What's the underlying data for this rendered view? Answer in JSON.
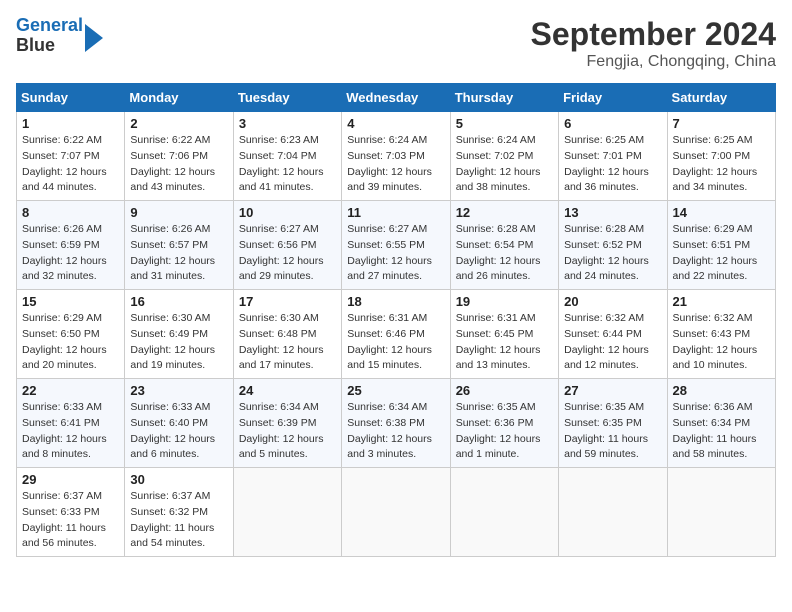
{
  "header": {
    "logo_line1": "General",
    "logo_line2": "Blue",
    "month": "September 2024",
    "location": "Fengjia, Chongqing, China"
  },
  "weekdays": [
    "Sunday",
    "Monday",
    "Tuesday",
    "Wednesday",
    "Thursday",
    "Friday",
    "Saturday"
  ],
  "weeks": [
    [
      {
        "day": "1",
        "sunrise": "6:22 AM",
        "sunset": "7:07 PM",
        "daylight": "12 hours and 44 minutes."
      },
      {
        "day": "2",
        "sunrise": "6:22 AM",
        "sunset": "7:06 PM",
        "daylight": "12 hours and 43 minutes."
      },
      {
        "day": "3",
        "sunrise": "6:23 AM",
        "sunset": "7:04 PM",
        "daylight": "12 hours and 41 minutes."
      },
      {
        "day": "4",
        "sunrise": "6:24 AM",
        "sunset": "7:03 PM",
        "daylight": "12 hours and 39 minutes."
      },
      {
        "day": "5",
        "sunrise": "6:24 AM",
        "sunset": "7:02 PM",
        "daylight": "12 hours and 38 minutes."
      },
      {
        "day": "6",
        "sunrise": "6:25 AM",
        "sunset": "7:01 PM",
        "daylight": "12 hours and 36 minutes."
      },
      {
        "day": "7",
        "sunrise": "6:25 AM",
        "sunset": "7:00 PM",
        "daylight": "12 hours and 34 minutes."
      }
    ],
    [
      {
        "day": "8",
        "sunrise": "6:26 AM",
        "sunset": "6:59 PM",
        "daylight": "12 hours and 32 minutes."
      },
      {
        "day": "9",
        "sunrise": "6:26 AM",
        "sunset": "6:57 PM",
        "daylight": "12 hours and 31 minutes."
      },
      {
        "day": "10",
        "sunrise": "6:27 AM",
        "sunset": "6:56 PM",
        "daylight": "12 hours and 29 minutes."
      },
      {
        "day": "11",
        "sunrise": "6:27 AM",
        "sunset": "6:55 PM",
        "daylight": "12 hours and 27 minutes."
      },
      {
        "day": "12",
        "sunrise": "6:28 AM",
        "sunset": "6:54 PM",
        "daylight": "12 hours and 26 minutes."
      },
      {
        "day": "13",
        "sunrise": "6:28 AM",
        "sunset": "6:52 PM",
        "daylight": "12 hours and 24 minutes."
      },
      {
        "day": "14",
        "sunrise": "6:29 AM",
        "sunset": "6:51 PM",
        "daylight": "12 hours and 22 minutes."
      }
    ],
    [
      {
        "day": "15",
        "sunrise": "6:29 AM",
        "sunset": "6:50 PM",
        "daylight": "12 hours and 20 minutes."
      },
      {
        "day": "16",
        "sunrise": "6:30 AM",
        "sunset": "6:49 PM",
        "daylight": "12 hours and 19 minutes."
      },
      {
        "day": "17",
        "sunrise": "6:30 AM",
        "sunset": "6:48 PM",
        "daylight": "12 hours and 17 minutes."
      },
      {
        "day": "18",
        "sunrise": "6:31 AM",
        "sunset": "6:46 PM",
        "daylight": "12 hours and 15 minutes."
      },
      {
        "day": "19",
        "sunrise": "6:31 AM",
        "sunset": "6:45 PM",
        "daylight": "12 hours and 13 minutes."
      },
      {
        "day": "20",
        "sunrise": "6:32 AM",
        "sunset": "6:44 PM",
        "daylight": "12 hours and 12 minutes."
      },
      {
        "day": "21",
        "sunrise": "6:32 AM",
        "sunset": "6:43 PM",
        "daylight": "12 hours and 10 minutes."
      }
    ],
    [
      {
        "day": "22",
        "sunrise": "6:33 AM",
        "sunset": "6:41 PM",
        "daylight": "12 hours and 8 minutes."
      },
      {
        "day": "23",
        "sunrise": "6:33 AM",
        "sunset": "6:40 PM",
        "daylight": "12 hours and 6 minutes."
      },
      {
        "day": "24",
        "sunrise": "6:34 AM",
        "sunset": "6:39 PM",
        "daylight": "12 hours and 5 minutes."
      },
      {
        "day": "25",
        "sunrise": "6:34 AM",
        "sunset": "6:38 PM",
        "daylight": "12 hours and 3 minutes."
      },
      {
        "day": "26",
        "sunrise": "6:35 AM",
        "sunset": "6:36 PM",
        "daylight": "12 hours and 1 minute."
      },
      {
        "day": "27",
        "sunrise": "6:35 AM",
        "sunset": "6:35 PM",
        "daylight": "11 hours and 59 minutes."
      },
      {
        "day": "28",
        "sunrise": "6:36 AM",
        "sunset": "6:34 PM",
        "daylight": "11 hours and 58 minutes."
      }
    ],
    [
      {
        "day": "29",
        "sunrise": "6:37 AM",
        "sunset": "6:33 PM",
        "daylight": "11 hours and 56 minutes."
      },
      {
        "day": "30",
        "sunrise": "6:37 AM",
        "sunset": "6:32 PM",
        "daylight": "11 hours and 54 minutes."
      },
      null,
      null,
      null,
      null,
      null
    ]
  ]
}
